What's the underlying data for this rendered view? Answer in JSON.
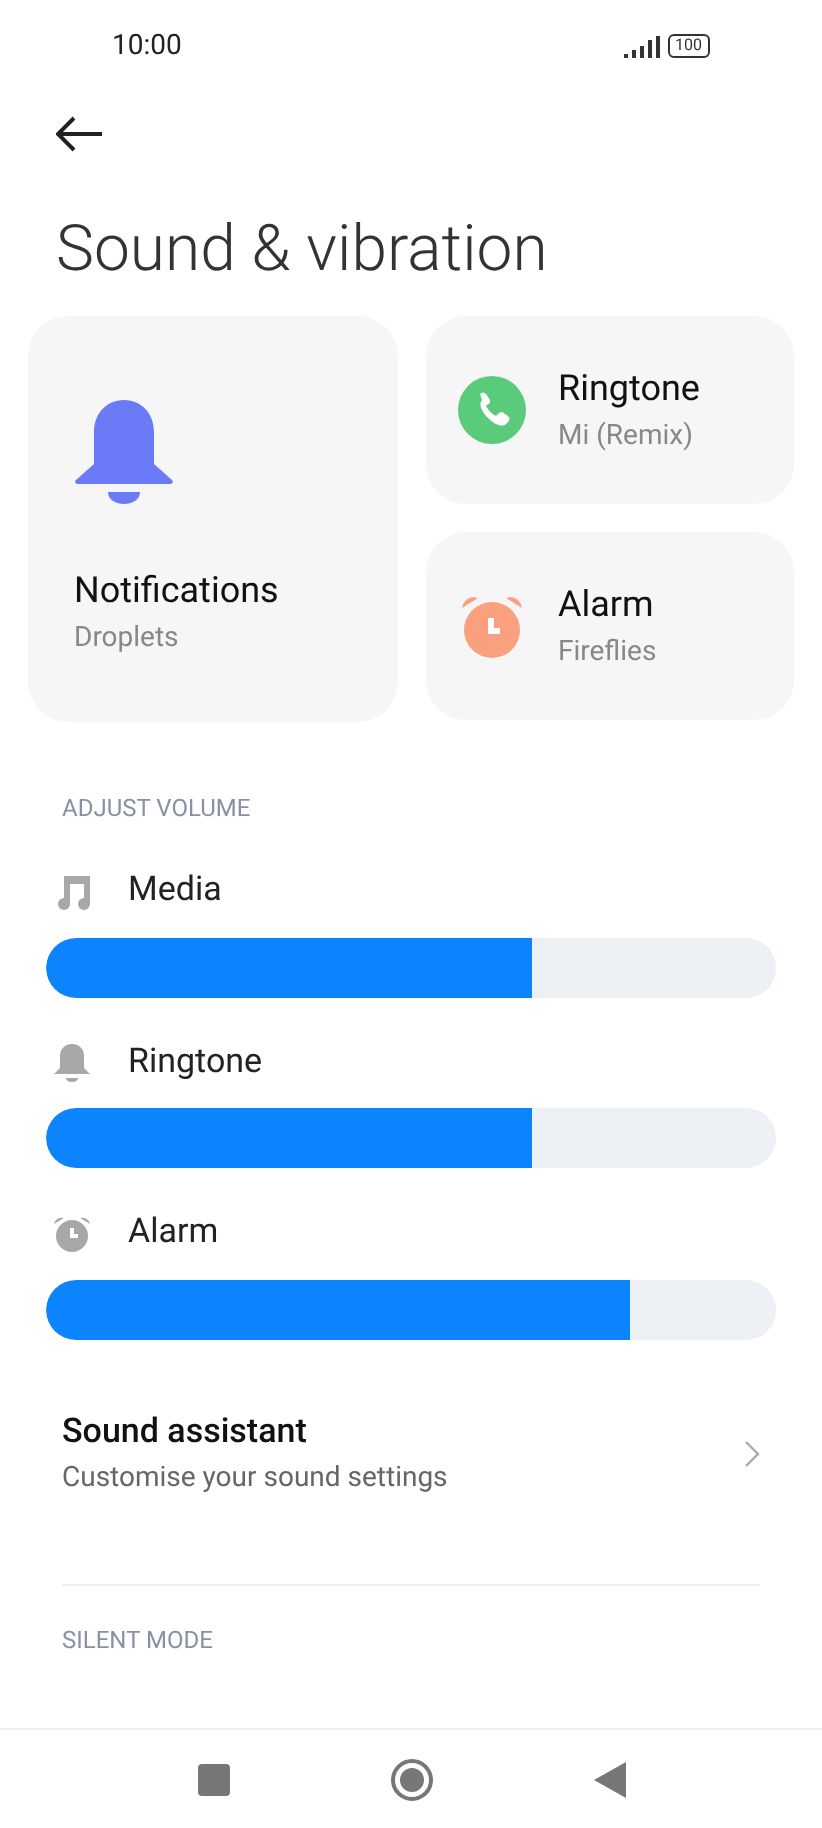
{
  "status_bar": {
    "time": "10:00",
    "battery": "100"
  },
  "title": "Sound & vibration",
  "cards": [
    {
      "kind": "bell",
      "title": "Notifications",
      "subtitle": "Droplets"
    },
    {
      "kind": "phone",
      "title": "Ringtone",
      "subtitle": "Mi (Remix)"
    },
    {
      "kind": "alarm",
      "title": "Alarm",
      "subtitle": "Fireflies"
    }
  ],
  "volume_section": "ADJUST VOLUME",
  "volumes": [
    {
      "kind": "music",
      "label": "Media",
      "level": 0.666
    },
    {
      "kind": "bell",
      "label": "Ringtone",
      "level": 0.666
    },
    {
      "kind": "alarm",
      "label": "Alarm",
      "level": 0.8
    }
  ],
  "sound_assistant": {
    "title": "Sound assistant",
    "subtitle": "Customise your sound settings"
  },
  "next_section": "SILENT MODE"
}
